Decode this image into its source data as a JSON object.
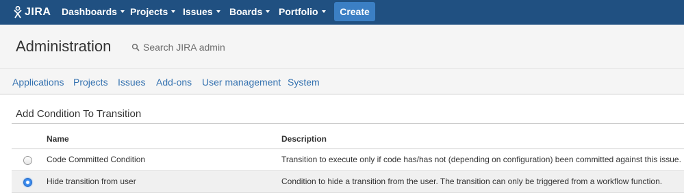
{
  "topbar": {
    "logo_text": "JIRA",
    "nav": [
      {
        "label": "Dashboards"
      },
      {
        "label": "Projects"
      },
      {
        "label": "Issues"
      },
      {
        "label": "Boards"
      },
      {
        "label": "Portfolio"
      }
    ],
    "create_label": "Create"
  },
  "admin": {
    "title": "Administration",
    "search_text": "Search JIRA admin",
    "tabs": [
      {
        "label": "Applications"
      },
      {
        "label": "Projects"
      },
      {
        "label": "Issues"
      },
      {
        "label": "Add-ons"
      },
      {
        "label": "User management"
      },
      {
        "label": "System"
      }
    ]
  },
  "content": {
    "section_title": "Add Condition To Transition",
    "columns": {
      "name": "Name",
      "description": "Description"
    },
    "rows": [
      {
        "name": "Code Committed Condition",
        "description": "Transition to execute only if code has/has not (depending on configuration) been committed against this issue.",
        "selected": false
      },
      {
        "name": "Hide transition from user",
        "description": "Condition to hide a transition from the user. The transition can only be triggered from a workflow function.",
        "selected": true
      }
    ]
  },
  "colors": {
    "topbar": "#205081",
    "create_button": "#3b7fc4",
    "link": "#3572b0",
    "header_bg": "#f5f5f5"
  },
  "icons": {
    "logo": "jira-logo-icon",
    "caret": "chevron-down-icon",
    "search": "search-icon"
  }
}
